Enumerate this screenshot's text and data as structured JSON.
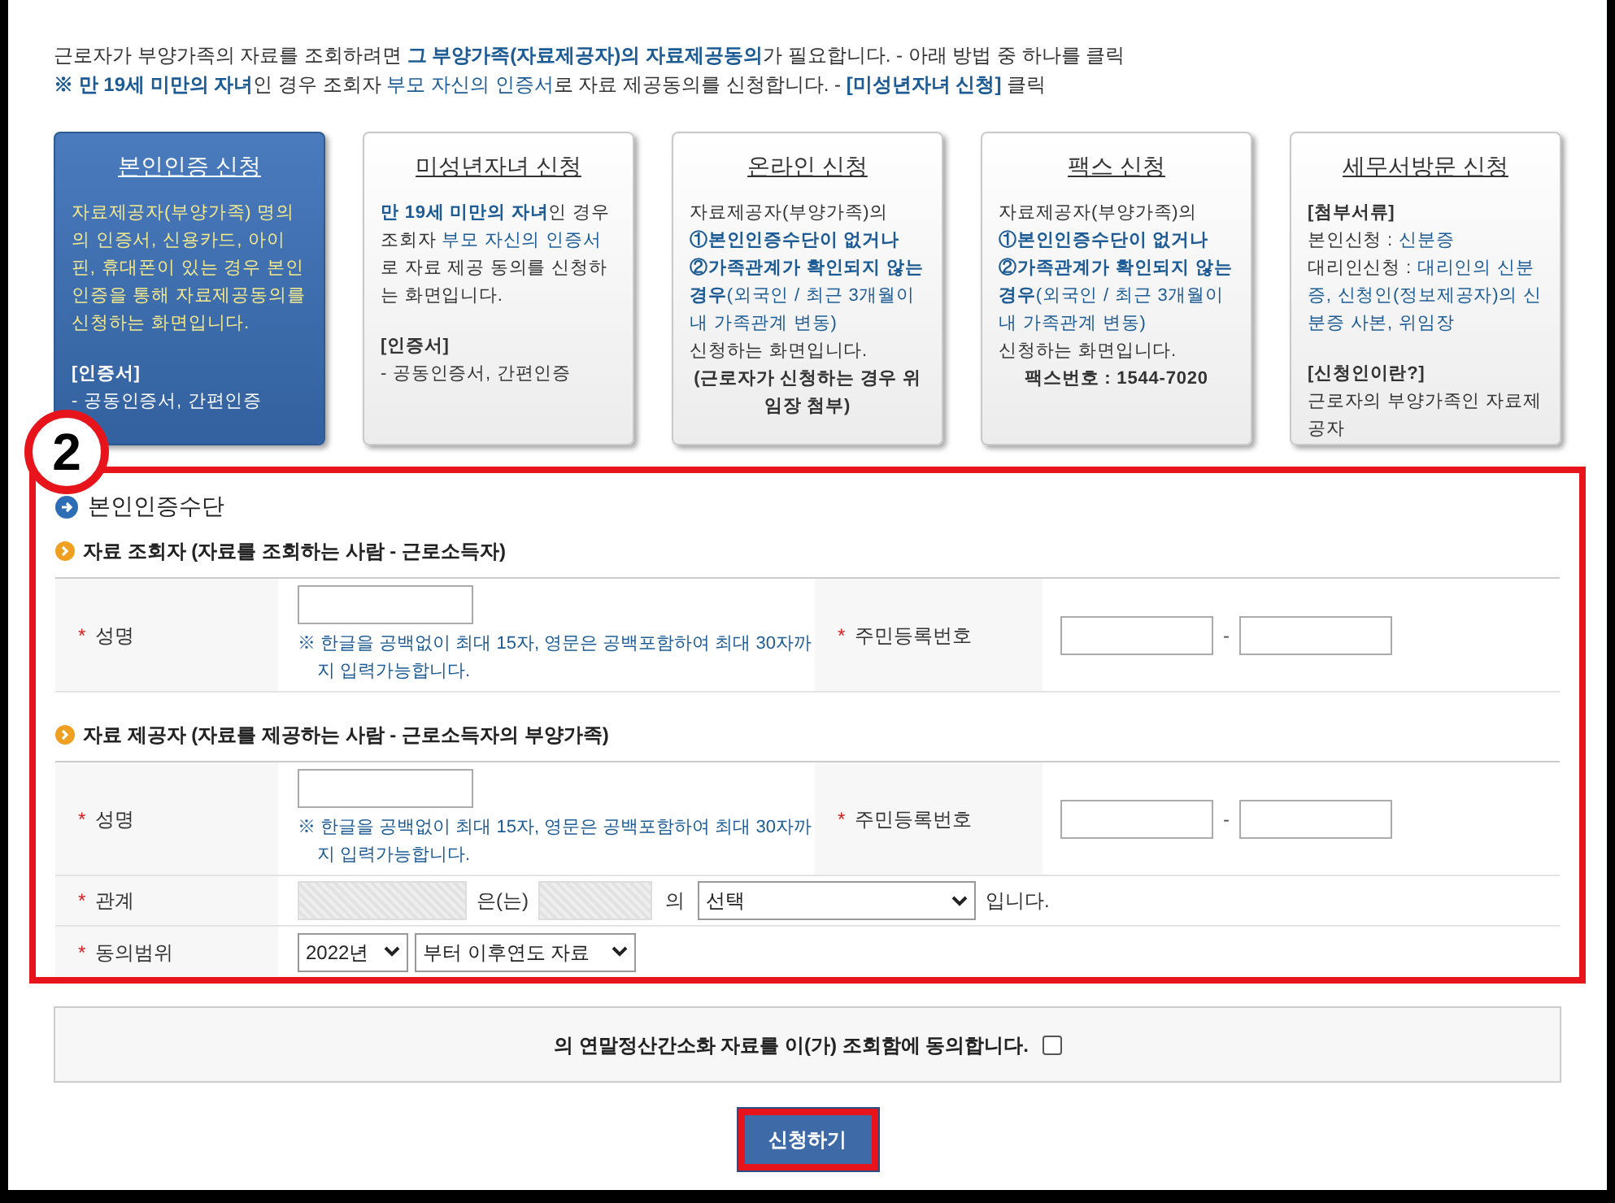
{
  "intro": [
    [
      {
        "text": "근로자가 부양가족의 자료를 조회하려면 ",
        "kind": "plain"
      },
      {
        "text": "그 부양가족(자료제공자)의 자료제공동의",
        "kind": "link-bold"
      },
      {
        "text": "가 필요합니다. - 아래 방법 중 하나를 클릭",
        "kind": "plain"
      }
    ],
    [
      {
        "text": "※ 만 19세 미만의 자녀",
        "kind": "link-bold"
      },
      {
        "text": "인 경우 조회자 ",
        "kind": "plain"
      },
      {
        "text": "부모 자신의 인증서",
        "kind": "link"
      },
      {
        "text": "로 자료 제공동의를 신청합니다. - ",
        "kind": "plain"
      },
      {
        "text": "[미성년자녀 신청]",
        "kind": "link-bold"
      },
      {
        "text": " 클릭",
        "kind": "plain"
      }
    ]
  ],
  "cards": [
    {
      "title": "본인인증 신청",
      "selected": true,
      "sections": [
        [
          {
            "segs": [
              {
                "text": "자료제공자(부양가족) 명의의 인증서, 신용카드, 아이핀, 휴대폰이 있는 경우 본인 인증을 통해 자료제공동의를 신청하는 화면입니다.",
                "kind": "highlight"
              }
            ]
          }
        ],
        [
          {
            "segs": [
              {
                "text": "[인증서]",
                "kind": "bold"
              }
            ]
          },
          {
            "segs": [
              {
                "text": "- 공동인증서, 간편인증",
                "kind": "plain"
              }
            ]
          }
        ]
      ]
    },
    {
      "title": "미성년자녀 신청",
      "selected": false,
      "sections": [
        [
          {
            "segs": [
              {
                "text": "만 19세 미만의 자녀",
                "kind": "link-bold"
              },
              {
                "text": "인 경우 조회자 ",
                "kind": "plain"
              },
              {
                "text": "부모 자신의 인증서",
                "kind": "link"
              },
              {
                "text": "로 자료 제공 동의를 신청하는 화면입니다.",
                "kind": "plain"
              }
            ]
          }
        ],
        [
          {
            "segs": [
              {
                "text": "[인증서]",
                "kind": "bold"
              }
            ]
          },
          {
            "segs": [
              {
                "text": "- 공동인증서, 간편인증",
                "kind": "plain"
              }
            ]
          }
        ]
      ]
    },
    {
      "title": "온라인 신청",
      "selected": false,
      "sections": [
        [
          {
            "segs": [
              {
                "text": "자료제공자(부양가족)의",
                "kind": "plain"
              }
            ]
          },
          {
            "segs": [
              {
                "text": "①본인인증수단이 없거나",
                "kind": "link-bold"
              }
            ]
          },
          {
            "segs": [
              {
                "text": "②가족관계가 확인되지 않는 경우",
                "kind": "link-bold"
              },
              {
                "text": "(외국인 / 최근 3개월이내 가족관계 변동)",
                "kind": "link"
              }
            ]
          },
          {
            "segs": [
              {
                "text": "신청하는 화면입니다.",
                "kind": "plain"
              }
            ]
          },
          {
            "kind": "note",
            "segs": [
              {
                "text": "(근로자가 신청하는 경우 위임장 첨부)",
                "kind": "bold"
              }
            ]
          }
        ]
      ]
    },
    {
      "title": "팩스 신청",
      "selected": false,
      "sections": [
        [
          {
            "segs": [
              {
                "text": "자료제공자(부양가족)의",
                "kind": "plain"
              }
            ]
          },
          {
            "segs": [
              {
                "text": "①본인인증수단이 없거나",
                "kind": "link-bold"
              }
            ]
          },
          {
            "segs": [
              {
                "text": "②가족관계가 확인되지 않는 경우",
                "kind": "link-bold"
              },
              {
                "text": "(외국인 / 최근 3개월이내 가족관계 변동)",
                "kind": "link"
              }
            ]
          },
          {
            "segs": [
              {
                "text": "신청하는 화면입니다.",
                "kind": "plain"
              }
            ]
          },
          {
            "kind": "note",
            "segs": [
              {
                "text": "팩스번호 : 1544-7020",
                "kind": "bold"
              }
            ]
          }
        ]
      ]
    },
    {
      "title": "세무서방문 신청",
      "selected": false,
      "sections": [
        [
          {
            "segs": [
              {
                "text": "[첨부서류]",
                "kind": "bold"
              }
            ]
          },
          {
            "segs": [
              {
                "text": "본인신청 : ",
                "kind": "plain"
              },
              {
                "text": "신분증",
                "kind": "link"
              }
            ]
          },
          {
            "segs": [
              {
                "text": "대리인신청 : ",
                "kind": "plain"
              },
              {
                "text": "대리인의 신분증, 신청인(정보제공자)의 신분증 사본, 위임장",
                "kind": "link"
              }
            ]
          }
        ],
        [
          {
            "segs": [
              {
                "text": "[신청인이란?]",
                "kind": "bold"
              }
            ]
          },
          {
            "segs": [
              {
                "text": "근로자의 부양가족인 자료제공자",
                "kind": "plain"
              }
            ]
          }
        ]
      ]
    }
  ],
  "annotation": "2",
  "form": {
    "title": "본인인증수단",
    "groups": [
      {
        "title": "자료 조회자 (자료를 조회하는 사람 - 근로소득자)",
        "rows": [
          {
            "kind": "name-id",
            "mark": "*",
            "label": "성명",
            "hint": "※ 한글을 공백없이 최대 15자, 영문은 공백포함하여 최대 30자까지 입력가능합니다.",
            "id_mark": "*",
            "id_label": "주민등록번호",
            "separator": "-"
          }
        ]
      },
      {
        "title": "자료 제공자 (자료를 제공하는 사람 - 근로소득자의 부양가족)",
        "rows": [
          {
            "kind": "name-id",
            "mark": "*",
            "label": "성명",
            "hint": "※ 한글을 공백없이 최대 15자, 영문은 공백포함하여 최대 30자까지 입력가능합니다.",
            "id_mark": "*",
            "id_label": "주민등록번호",
            "separator": "-"
          },
          {
            "kind": "relation",
            "mark": "*",
            "label": "관계",
            "between": "은(는)",
            "of": "의",
            "select": "선택",
            "suffix": "입니다."
          },
          {
            "kind": "range",
            "mark": "*",
            "label": "동의범위",
            "selects": [
              "2022년",
              "부터 이후연도 자료"
            ]
          }
        ]
      }
    ]
  },
  "agreement": {
    "text": "의 연말정산간소화 자료를 이(가) 조회함에 동의합니다.",
    "checked": false
  },
  "submit": "신청하기"
}
